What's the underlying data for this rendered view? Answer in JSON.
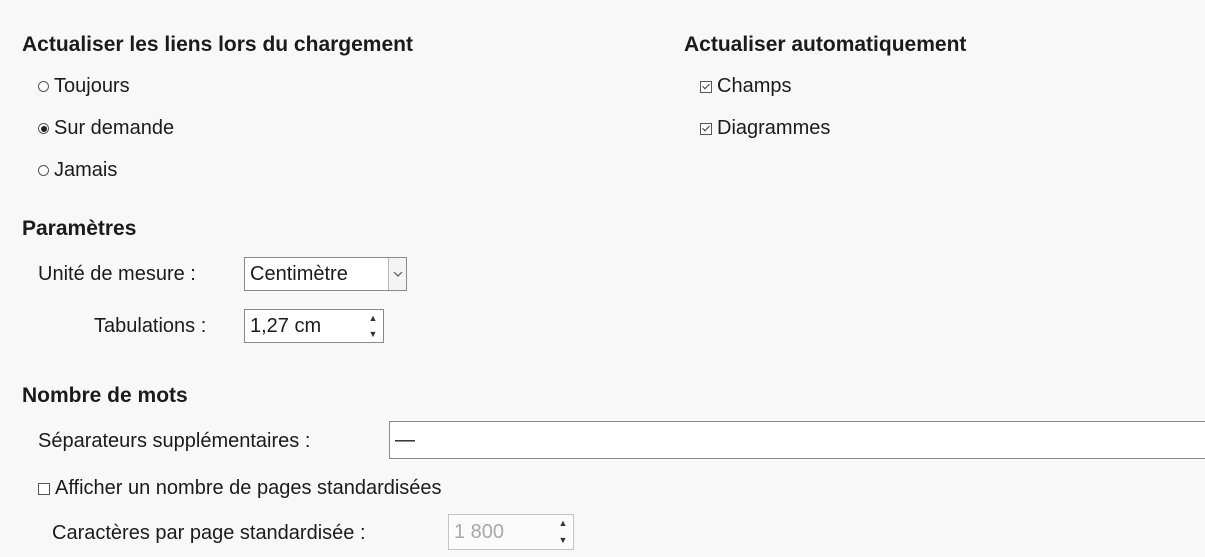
{
  "update_links": {
    "heading": "Actualiser les liens lors du chargement",
    "options": [
      {
        "label": "Toujours",
        "selected": false
      },
      {
        "label": "Sur demande",
        "selected": true
      },
      {
        "label": "Jamais",
        "selected": false
      }
    ]
  },
  "auto_update": {
    "heading": "Actualiser automatiquement",
    "options": [
      {
        "label": "Champs",
        "checked": true
      },
      {
        "label": "Diagrammes",
        "checked": true
      }
    ]
  },
  "settings": {
    "heading": "Paramètres",
    "unit_label": "Unité de mesure :",
    "unit_value": "Centimètre",
    "tabs_label": "Tabulations :",
    "tabs_value": "1,27 cm"
  },
  "word_count": {
    "heading": "Nombre de mots",
    "separators_label": "Séparateurs supplémentaires :",
    "separators_value": "—",
    "show_pages_label": "Afficher un nombre de pages standardisées",
    "show_pages_checked": false,
    "chars_label": "Caractères par page standardisée :",
    "chars_value": "1 800"
  }
}
